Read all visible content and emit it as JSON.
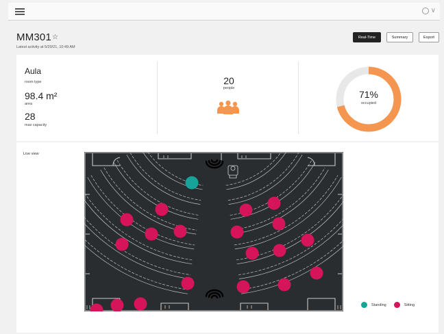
{
  "header": {
    "menu_icon": "hamburger-icon",
    "user_icon": "user-circle-icon",
    "chevron": "∨"
  },
  "room": {
    "name": "MM301",
    "favorite_icon": "☆",
    "last_activity": "Latest activity at 5/20/21, 10:49 AM"
  },
  "actions": {
    "realtime": "Real-Time",
    "summary": "Summary",
    "export": "Export"
  },
  "stats": {
    "room_type_value": "Aula",
    "room_type_label": "room type",
    "area_value": "98.4 m²",
    "area_label": "area",
    "capacity_value": "28",
    "capacity_label": "max capacity",
    "people_value": "20",
    "people_label": "people",
    "people_icon": "people-group-icon",
    "occupied_value": "71%",
    "occupied_label": "occupied",
    "occupied_fraction": 0.71
  },
  "live": {
    "label": "Live view",
    "standing_count": 1,
    "sitting_count": 19
  },
  "legend": {
    "standing": "Standing",
    "sitting": "Sitting"
  },
  "colors": {
    "accent_orange": "#f4964f",
    "standing": "#15a39a",
    "sitting": "#d6145a",
    "map_bg": "#2a2d30",
    "primary_button": "#232323"
  }
}
